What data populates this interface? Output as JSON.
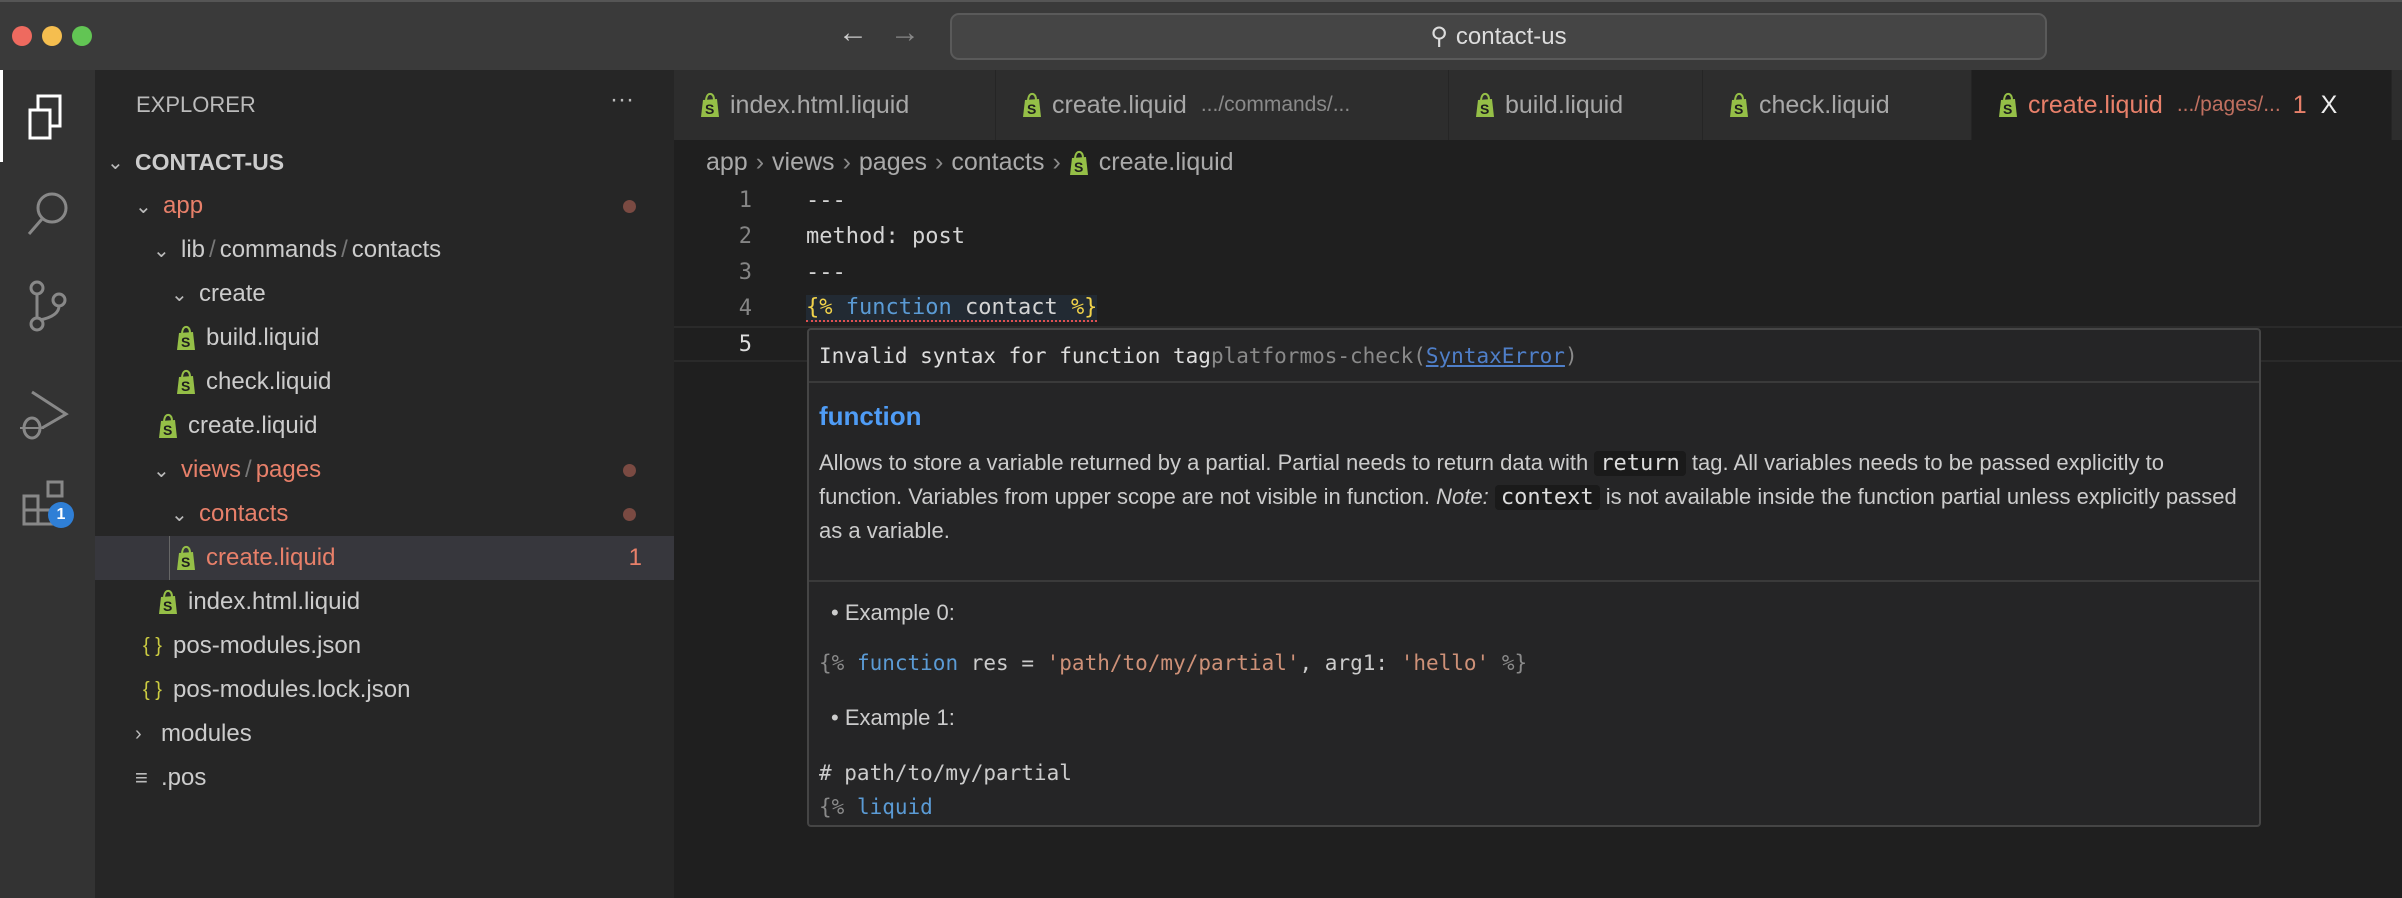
{
  "window": {
    "search": "contact-us"
  },
  "activity": {
    "extensions_badge": "1"
  },
  "sidebar": {
    "title": "EXPLORER",
    "more": "···",
    "root": "CONTACT-US",
    "rows": [
      {
        "label": "app"
      },
      {
        "parts": [
          "lib",
          "commands",
          "contacts"
        ]
      },
      {
        "label": "create"
      },
      {
        "label": "build.liquid"
      },
      {
        "label": "check.liquid"
      },
      {
        "label": "create.liquid"
      },
      {
        "parts": [
          "views",
          "pages"
        ]
      },
      {
        "label": "contacts"
      },
      {
        "label": "create.liquid",
        "badge": "1"
      },
      {
        "label": "index.html.liquid"
      },
      {
        "label": "pos-modules.json"
      },
      {
        "label": "pos-modules.lock.json"
      },
      {
        "label": "modules"
      },
      {
        "label": ".pos"
      }
    ]
  },
  "tabs": [
    {
      "label": "index.html.liquid"
    },
    {
      "label": "create.liquid",
      "desc": ".../commands/..."
    },
    {
      "label": "build.liquid"
    },
    {
      "label": "check.liquid"
    },
    {
      "label": "create.liquid",
      "desc": ".../pages/...",
      "badge": "1",
      "close": "X"
    }
  ],
  "breadcrumb": [
    "app",
    "views",
    "pages",
    "contacts",
    "create.liquid"
  ],
  "code": {
    "lines": [
      "1",
      "2",
      "3",
      "4",
      "5"
    ],
    "l1": "---",
    "l2": "method: post",
    "l3": "---",
    "l4": {
      "open": "{%",
      "kw": "function",
      "name": "contact",
      "close": "%}"
    }
  },
  "hover": {
    "error": "Invalid syntax for function tag",
    "source": "platformos-check(",
    "code": "SyntaxError",
    "source_end": ")",
    "heading": "function",
    "desc1": "Allows to store a variable returned by a partial. Partial needs to return data with",
    "return": "return",
    "desc2": "tag. All variables needs to be passed explicitly to function. Variables from upper scope are not visible in function.",
    "note": "Note:",
    "context": "context",
    "desc3": "is not available inside the function partial unless explicitly passed as a variable.",
    "ex0": "Example 0:",
    "ex0_code": {
      "open": "{%",
      "kw": "function",
      "a": "res =",
      "s1": "'path/to/my/partial'",
      "b": ", arg1:",
      "s2": "'hello'",
      "close": "%}"
    },
    "ex1": "Example 1:",
    "ex1_l1": "# path/to/my/partial",
    "ex1_l2": {
      "open": "{%",
      "kw": "liquid"
    }
  },
  "colors": {
    "accent_error": "#e8806a",
    "liquid_icon": "#95bf47",
    "keyword": "#5b9bd5",
    "badge": "#2f7fd6"
  }
}
